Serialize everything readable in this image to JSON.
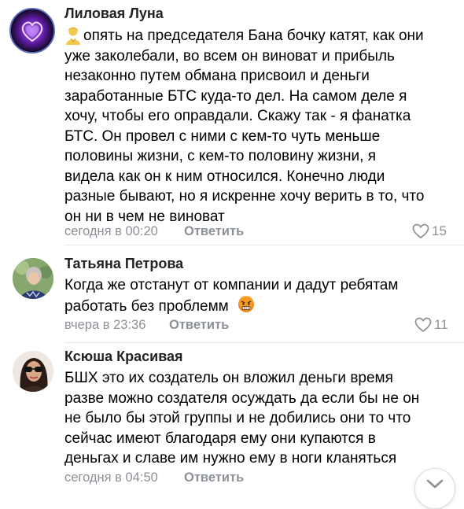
{
  "comments": [
    {
      "author": "Лиловая Луна",
      "lines": [
        "опять на председателя Бана бочку катят, как они",
        "уже заколебали, во всем он виноват и прибыль",
        "незаконно путем обмана присвоил и деньги",
        "заработанные БТС куда-то дел. На самом деле я",
        "хочу, чтобы его оправдали. Скажу так - я фанатка",
        "БТС. Он провел с ними с кем-то чуть меньше",
        "половины жизни, с кем-то половину жизни, я",
        "видела как он к ним относился. Конечно люди",
        "разные бывают, но я искренне хочу верить в то, что",
        "он ни в чем не виноват"
      ],
      "leading_emoji": "person-emoji",
      "time": "сегодня в 00:20",
      "reply_label": "Ответить",
      "likes": "15",
      "avatar": "purple-heart-avatar"
    },
    {
      "author": "Татьяна Петрова",
      "lines": [
        "Когда же отстанут от компании и дадут ребятам",
        "работать без проблемм"
      ],
      "trailing_emoji": "angry-face-emoji",
      "time": "вчера в 23:36",
      "reply_label": "Ответить",
      "likes": "11",
      "avatar": "woman-photo-avatar"
    },
    {
      "author": "Ксюша Красивая",
      "lines": [
        "БШХ это их создатель он вложил деньги время",
        "разве можно создателя осуждать да если бы не он",
        "не было бы этой группы и не добились они то что",
        "сейчас имеют благодаря ему они купаются в",
        "деньгах и славе им нужно ему в ноги кланяться"
      ],
      "time": "сегодня в 04:50",
      "reply_label": "Ответить",
      "avatar": "girl-photo-avatar"
    }
  ],
  "colors": {
    "meta_text": "#8c9097",
    "divider": "#e7e8ec"
  },
  "scroll_button_icon": "chevron-down-icon"
}
